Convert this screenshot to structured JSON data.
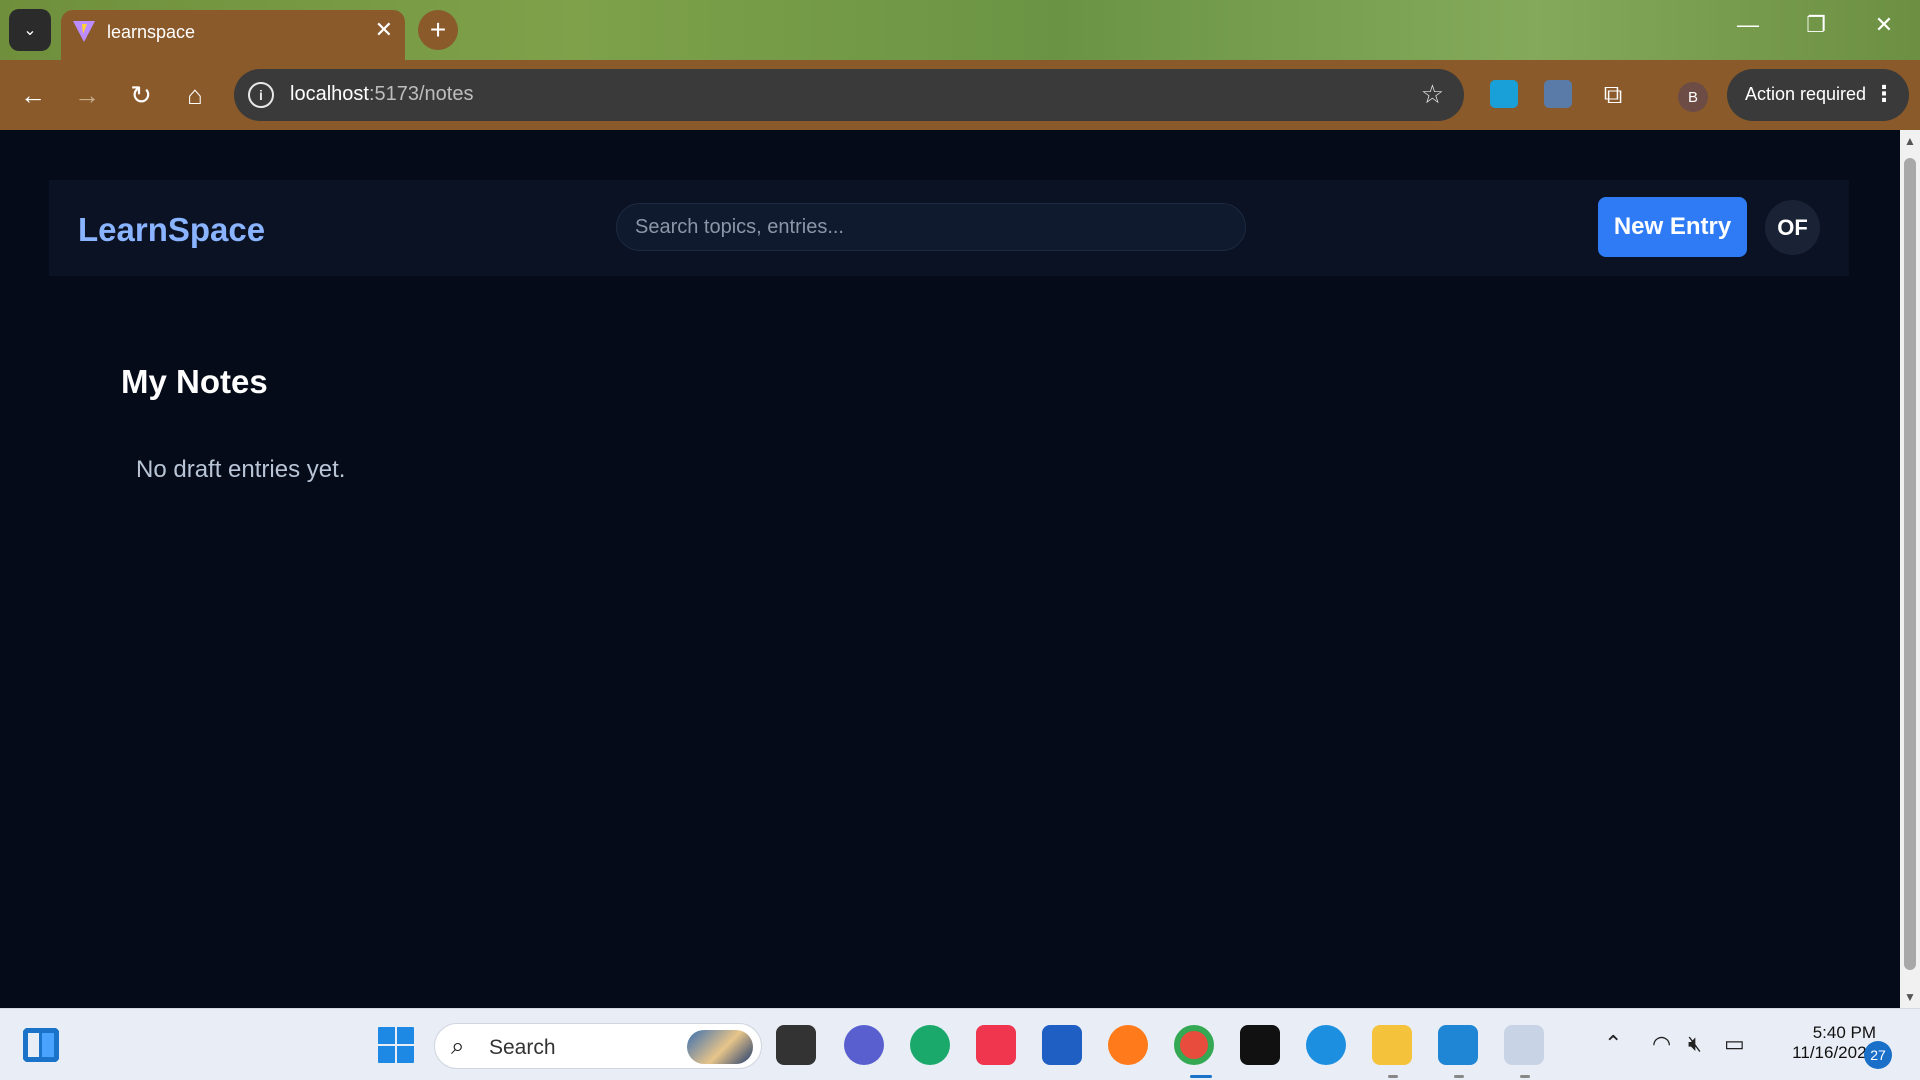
{
  "browser": {
    "tab_title": "learnspace",
    "tab_close": "✕",
    "new_tab": "+",
    "url_host": "localhost",
    "url_path": ":5173/notes",
    "profile_initial": "B",
    "action_required_label": "Action required"
  },
  "app": {
    "brand": "LearnSpace",
    "search_placeholder": "Search topics, entries...",
    "new_entry_label": "New Entry",
    "avatar_initials": "OF",
    "page_title": "My Notes",
    "empty_message": "No draft entries yet.",
    "accent_color": "#2f7bf6",
    "brand_color": "#8ab4ff"
  },
  "taskbar": {
    "search_label": "Search",
    "time": "5:40 PM",
    "date": "11/16/2025",
    "notification_count": "27"
  }
}
